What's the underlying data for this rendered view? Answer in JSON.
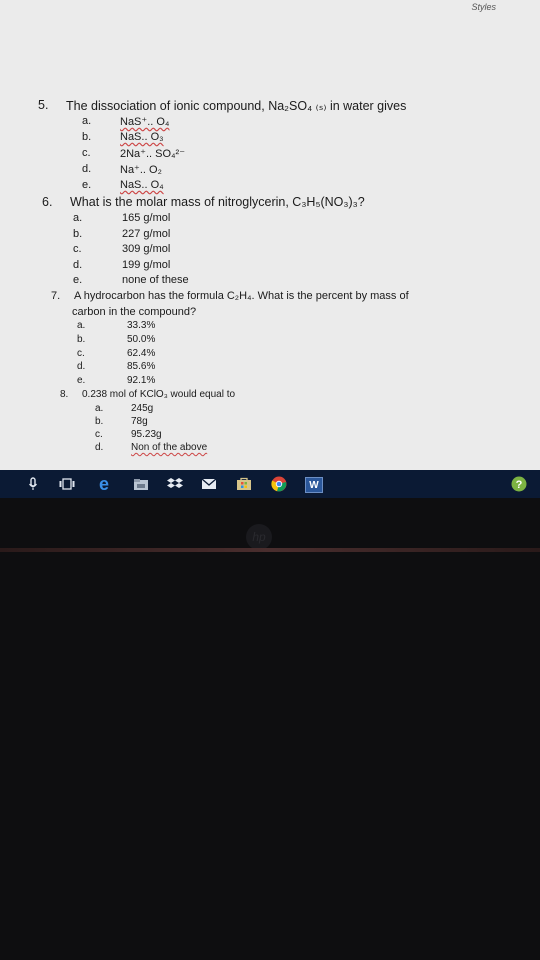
{
  "toolbar": {
    "styles_label": "Styles"
  },
  "q5": {
    "num": "5.",
    "text": "The dissociation of ionic compound, Na₂SO₄ ₍ₛ₎ in water gives",
    "opts": [
      {
        "l": "a.",
        "v": "NaS⁺.. O₄"
      },
      {
        "l": "b.",
        "v": "NaS.. O₃"
      },
      {
        "l": "c.",
        "v": "2Na⁺.. SO₄²⁻"
      },
      {
        "l": "d.",
        "v": "Na⁺.. O₂"
      },
      {
        "l": "e.",
        "v": "NaS.. O₄"
      }
    ]
  },
  "q6": {
    "num": "6.",
    "text": "What is the molar mass of nitroglycerin, C₃H₅(NO₃)₃?",
    "opts": [
      {
        "l": "a.",
        "v": "165 g/mol"
      },
      {
        "l": "b.",
        "v": "227 g/mol"
      },
      {
        "l": "c.",
        "v": "309 g/mol"
      },
      {
        "l": "d.",
        "v": "199 g/mol"
      },
      {
        "l": "e.",
        "v": "none of these"
      }
    ]
  },
  "q7": {
    "num": "7.",
    "text1": "A hydrocarbon has the formula C₂H₄. What is the percent by mass of",
    "text2": "carbon in the compound?",
    "opts": [
      {
        "l": "a.",
        "v": "33.3%"
      },
      {
        "l": "b.",
        "v": "50.0%"
      },
      {
        "l": "c.",
        "v": "62.4%"
      },
      {
        "l": "d.",
        "v": "85.6%"
      },
      {
        "l": "e.",
        "v": "92.1%"
      }
    ]
  },
  "q8": {
    "num": "8.",
    "text": "0.238 mol of KClO₃ would equal to",
    "opts": [
      {
        "l": "a.",
        "v": "245g"
      },
      {
        "l": "b.",
        "v": "78g"
      },
      {
        "l": "c.",
        "v": "95.23g"
      },
      {
        "l": "d.",
        "v": "Non of the above"
      }
    ]
  },
  "taskbar": {
    "word_label": "W"
  },
  "bezel": {
    "logo": "hp"
  }
}
